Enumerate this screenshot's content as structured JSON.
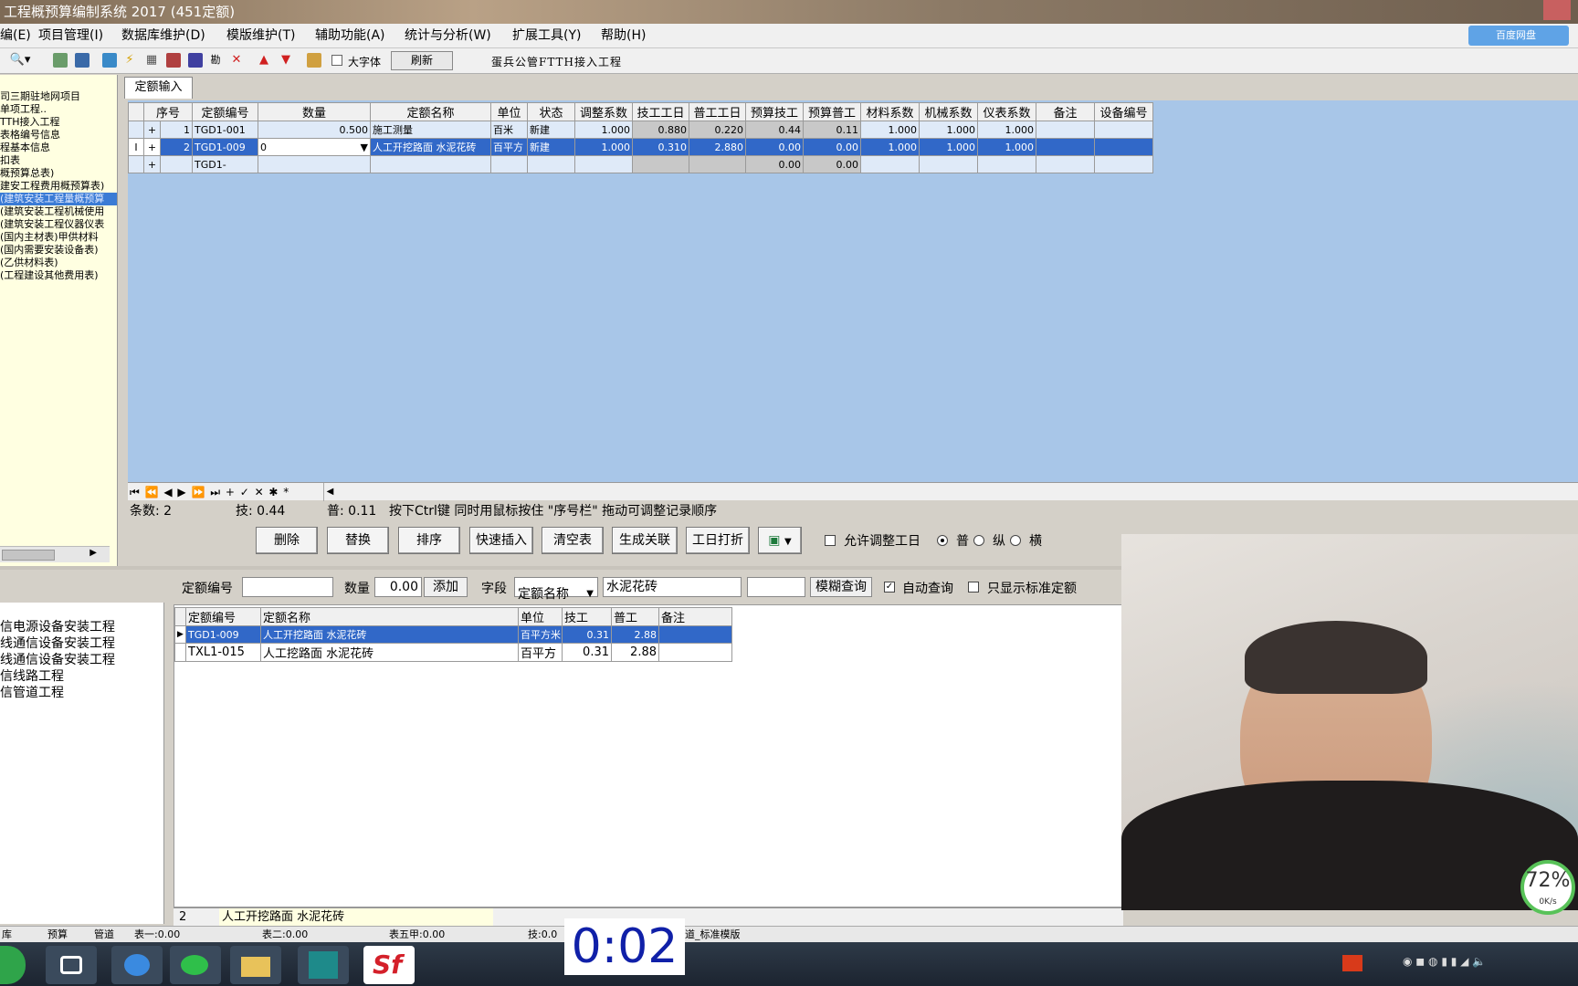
{
  "window": {
    "title": "工程概预算编制系统 2017 (451定额)"
  },
  "menu": {
    "items": [
      "编(E)",
      "项目管理(I)",
      "数据库维护(D)",
      "模版维护(T)",
      "辅助功能(A)",
      "统计与分析(W)",
      "扩展工具(Y)",
      "帮助(H)"
    ],
    "logo_text": "百度网盘"
  },
  "toolbar": {
    "bigfont_label": "大字体",
    "refresh_label": "刷新",
    "project_name": "蛋兵公管FTTH接入工程"
  },
  "sidebar": {
    "items": [
      "司三期驻地网项目",
      "单项工程..",
      "TTH接入工程",
      "表格编号信息",
      "程基本信息",
      "扣表",
      "概预算总表)",
      "建安工程费用概预算表)",
      "(建筑安装工程量概预算",
      "(建筑安装工程机械使用",
      "(建筑安装工程仪器仪表",
      "(国内主材表)甲供材料",
      "(国内需要安装设备表)",
      "(乙供材料表)",
      "(工程建设其他费用表)"
    ],
    "selected_index": 8
  },
  "main": {
    "tab_label": "定额输入",
    "columns": [
      "序号",
      "定额编号",
      "数量",
      "定额名称",
      "单位",
      "状态",
      "调整系数",
      "技工工日",
      "普工工日",
      "预算技工",
      "预算普工",
      "材料系数",
      "机械系数",
      "仪表系数",
      "备注",
      "设备编号"
    ],
    "rows": [
      {
        "seq": "1",
        "code": "TGD1-001",
        "qty": "0.500",
        "name": "施工测量",
        "unit": "百米",
        "state": "新建",
        "adj": "1.000",
        "jg": "0.880",
        "pg": "0.220",
        "ysjg": "0.44",
        "yspg": "0.11",
        "cl": "1.000",
        "jx": "1.000",
        "yb": "1.000"
      },
      {
        "seq": "2",
        "code": "TGD1-009",
        "qty": "0",
        "name": "人工开挖路面 水泥花砖",
        "unit": "百平方",
        "state": "新建",
        "adj": "1.000",
        "jg": "0.310",
        "pg": "2.880",
        "ysjg": "0.00",
        "yspg": "0.00",
        "cl": "1.000",
        "jx": "1.000",
        "yb": "1.000"
      },
      {
        "seq": "",
        "code": "TGD1-",
        "qty": "",
        "name": "",
        "unit": "",
        "state": "",
        "adj": "",
        "jg": "",
        "pg": "",
        "ysjg": "0.00",
        "yspg": "0.00",
        "cl": "",
        "jx": "",
        "yb": ""
      }
    ],
    "nav_symbols": "⏮ ⏪ ◀ ▶ ⏩ ⏭ + ✓ ✕ ✱ *",
    "status": {
      "count": "条数: 2",
      "ji": "技: 0.44",
      "pu": "普: 0.11",
      "hint": "按下Ctrl键 同时用鼠标按住 \"序号栏\" 拖动可调整记录顺序"
    }
  },
  "actions": {
    "buttons": [
      "删除",
      "替换",
      "排序",
      "快速插入",
      "清空表",
      "生成关联",
      "工日打折"
    ],
    "allow_adjust_label": "允许调整工日",
    "radio_pu": "普",
    "radio_zong": "纵",
    "radio_heng": "横"
  },
  "lower_left": {
    "items": [
      "信电源设备安装工程",
      "线通信设备安装工程",
      "线通信设备安装工程",
      "信线路工程",
      "信管道工程"
    ]
  },
  "search": {
    "code_label": "定额编号",
    "qty_label": "数量",
    "qty_value": "0.00",
    "add_label": "添加",
    "field_label": "字段",
    "field_value": "定额名称",
    "query_value": "水泥花砖",
    "fuzzy_label": "模糊查询",
    "auto_label": "自动查询",
    "std_only_label": "只显示标准定额"
  },
  "lower_grid": {
    "columns": [
      "定额编号",
      "定额名称",
      "单位",
      "技工",
      "普工",
      "备注"
    ],
    "rows": [
      {
        "code": "TGD1-009",
        "name": "人工开挖路面 水泥花砖",
        "unit": "百平方米",
        "jg": "0.31",
        "pg": "2.88",
        "note": ""
      },
      {
        "code": "TXL1-015",
        "name": "人工挖路面 水泥花砖",
        "unit": "百平方",
        "jg": "0.31",
        "pg": "2.88",
        "note": ""
      }
    ],
    "footer_num": "2",
    "footer_name": "人工开挖路面 水泥花砖"
  },
  "appstatus": {
    "items": [
      "库",
      "预算",
      "管道",
      "表一:0.00",
      "表二:0.00",
      "表五甲:0.00",
      "技:0.0",
      "道_标准模版"
    ]
  },
  "timer": "0:02",
  "network": {
    "percent": "72%",
    "rate": "0K/s"
  },
  "colors": {
    "grid_bg": "#a8c6e8",
    "selection": "#3168c8",
    "sidebar_bg": "#ffffe1"
  }
}
